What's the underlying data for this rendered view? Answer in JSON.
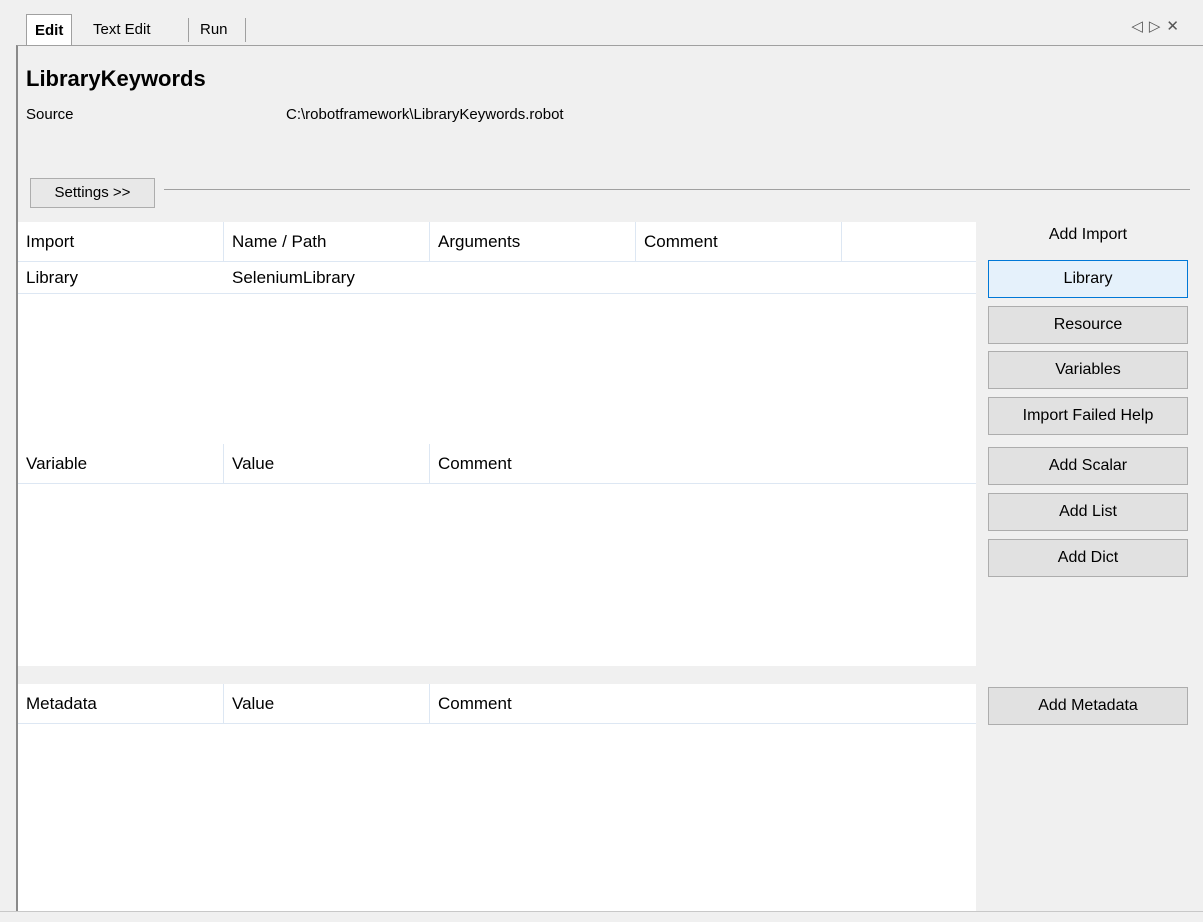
{
  "tabs": [
    {
      "label": "Edit",
      "active": true
    },
    {
      "label": "Text Edit",
      "active": false
    },
    {
      "label": "Run",
      "active": false
    }
  ],
  "window_controls": {
    "prev": "◁",
    "next": "▷",
    "close": "✕"
  },
  "title": "LibraryKeywords",
  "source": {
    "label": "Source",
    "value": "C:\\robotframework\\LibraryKeywords.robot"
  },
  "settings_button": "Settings >>",
  "imports": {
    "columns": [
      "Import",
      "Name / Path",
      "Arguments",
      "Comment",
      ""
    ],
    "rows": [
      [
        "Library",
        "SeleniumLibrary",
        "",
        "",
        ""
      ]
    ]
  },
  "variables": {
    "columns": [
      "Variable",
      "Value",
      "Comment"
    ]
  },
  "metadata": {
    "columns": [
      "Metadata",
      "Value",
      "Comment"
    ]
  },
  "side_panel": {
    "add_import_label": "Add Import",
    "library": "Library",
    "resource": "Resource",
    "variables": "Variables",
    "import_failed_help": "Import Failed Help",
    "add_scalar": "Add Scalar",
    "add_list": "Add List",
    "add_dict": "Add Dict",
    "add_metadata": "Add Metadata"
  }
}
